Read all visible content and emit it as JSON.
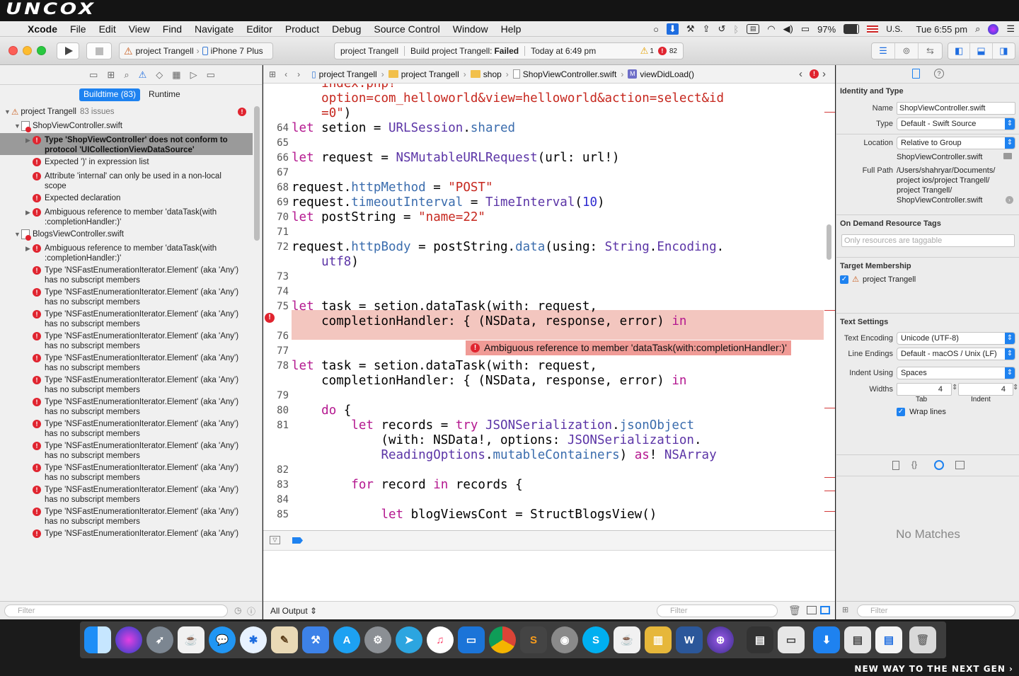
{
  "brand": {
    "top": "UNCOX",
    "bottom": "NEW WAY TO THE NEXT GEN ›"
  },
  "menubar": {
    "app": "Xcode",
    "items": [
      "File",
      "Edit",
      "View",
      "Find",
      "Navigate",
      "Editor",
      "Product",
      "Debug",
      "Source Control",
      "Window",
      "Help"
    ],
    "battery": "97%",
    "input": "U.S.",
    "clock": "Tue 6:55 pm"
  },
  "toolbar": {
    "scheme": "project Trangell",
    "device": "iPhone 7 Plus",
    "activity_project": "project Trangell",
    "activity_status": "Build project Trangell: ",
    "activity_result": "Failed",
    "activity_time": "Today at 6:49 pm",
    "warnings": "1",
    "errors": "82"
  },
  "navigator": {
    "seg_buildtime": "Buildtime (83)",
    "seg_runtime": "Runtime",
    "project": "project Trangell",
    "issues": "83 issues",
    "file1": "ShopViewController.swift",
    "file1_issues": [
      "Type 'ShopViewController' does not conform to protocol 'UICollectionViewDataSource'",
      "Expected ')' in expression list",
      "Attribute 'internal' can only be used in a non-local scope",
      "Expected declaration",
      "Ambiguous reference to member 'dataTask(with :completionHandler:)'"
    ],
    "file2": "BlogsViewController.swift",
    "file2_issues": [
      "Ambiguous reference to member 'dataTask(with :completionHandler:)'",
      "Type 'NSFastEnumerationIterator.Element' (aka 'Any') has no subscript members",
      "Type 'NSFastEnumerationIterator.Element' (aka 'Any') has no subscript members",
      "Type 'NSFastEnumerationIterator.Element' (aka 'Any') has no subscript members",
      "Type 'NSFastEnumerationIterator.Element' (aka 'Any') has no subscript members",
      "Type 'NSFastEnumerationIterator.Element' (aka 'Any') has no subscript members",
      "Type 'NSFastEnumerationIterator.Element' (aka 'Any') has no subscript members",
      "Type 'NSFastEnumerationIterator.Element' (aka 'Any') has no subscript members",
      "Type 'NSFastEnumerationIterator.Element' (aka 'Any') has no subscript members",
      "Type 'NSFastEnumerationIterator.Element' (aka 'Any') has no subscript members",
      "Type 'NSFastEnumerationIterator.Element' (aka 'Any') has no subscript members",
      "Type 'NSFastEnumerationIterator.Element' (aka 'Any') has no subscript members",
      "Type 'NSFastEnumerationIterator.Element' (aka 'Any') has no subscript members",
      "Type 'NSFastEnumerationIterator.Element' (aka 'Any')"
    ],
    "filter_placeholder": "Filter"
  },
  "jumpbar": {
    "c1": "project Trangell",
    "c2": "project Trangell",
    "c3": "shop",
    "c4": "ShopViewController.swift",
    "c5": "viewDidLoad()"
  },
  "editor": {
    "error_line_number": "75",
    "error_message": "Ambiguous reference to member 'dataTask(with:completionHandler:)'",
    "line_numbers": [
      "64",
      "65",
      "66",
      "67",
      "68",
      "69",
      "70",
      "71",
      "72",
      "73",
      "74",
      "75",
      "76",
      "77",
      "78",
      "79",
      "80",
      "81",
      "82",
      "83",
      "84",
      "85"
    ]
  },
  "debug": {
    "output_select": "All Output ⇕",
    "filter_placeholder": "Filter"
  },
  "inspector": {
    "identity_head": "Identity and Type",
    "name_label": "Name",
    "name_value": "ShopViewController.swift",
    "type_label": "Type",
    "type_value": "Default - Swift Source",
    "location_label": "Location",
    "location_value": "Relative to Group",
    "location_file": "ShopViewController.swift",
    "fullpath_label": "Full Path",
    "fullpath_value": "/Users/shahryar/Documents/ project ios/project Trangell/ project Trangell/ ShopViewController.swift",
    "ondemand_head": "On Demand Resource Tags",
    "tags_placeholder": "Only resources are taggable",
    "target_head": "Target Membership",
    "target_item": "project Trangell",
    "text_head": "Text Settings",
    "encoding_label": "Text Encoding",
    "encoding_value": "Unicode (UTF-8)",
    "endings_label": "Line Endings",
    "endings_value": "Default - macOS / Unix (LF)",
    "indent_label": "Indent Using",
    "indent_value": "Spaces",
    "widths_label": "Widths",
    "tab_value": "4",
    "indent_width_value": "4",
    "tab_caption": "Tab",
    "indent_caption": "Indent",
    "wrap_label": "Wrap lines",
    "no_matches": "No Matches",
    "filter_placeholder": "Filter"
  },
  "colors": {
    "error": "#e0242f",
    "accent": "#1e82f0",
    "keyword": "#b4178f",
    "string": "#c6271e",
    "type": "#5b34a6"
  }
}
